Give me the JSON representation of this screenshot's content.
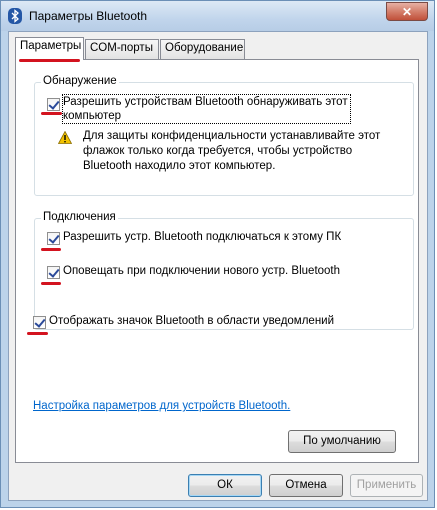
{
  "window": {
    "title": "Параметры Bluetooth",
    "close_label": "✕"
  },
  "tabs": [
    {
      "label": "Параметры",
      "active": true
    },
    {
      "label": "COM-порты",
      "active": false
    },
    {
      "label": "Оборудование",
      "active": false
    }
  ],
  "discovery": {
    "group_label": "Обнаружение",
    "allow_discovery_line1": "Разрешить устройствам Bluetooth обнаруживать этот",
    "allow_discovery_line2": "компьютер",
    "allow_discovery_checked": true,
    "warning_line1": "Для защиты конфиденциальности устанавливайте этот",
    "warning_line2": "флажок только когда требуется, чтобы устройство",
    "warning_line3": "Bluetooth находило этот компьютер."
  },
  "connections": {
    "group_label": "Подключения",
    "allow_connect": "Разрешить устр. Bluetooth подключаться к этому ПК",
    "allow_connect_checked": true,
    "notify_new": "Оповещать при подключении нового устр. Bluetooth",
    "notify_new_checked": true
  },
  "show_icon": {
    "label": "Отображать значок Bluetooth в области уведомлений",
    "checked": true
  },
  "settings_link": "Настройка параметров для устройств Bluetooth.",
  "buttons": {
    "defaults": "По умолчанию",
    "ok": "ОК",
    "cancel": "Отмена",
    "apply": "Применить"
  },
  "colors": {
    "annotation_red": "#d3131f",
    "link": "#0066cc"
  }
}
